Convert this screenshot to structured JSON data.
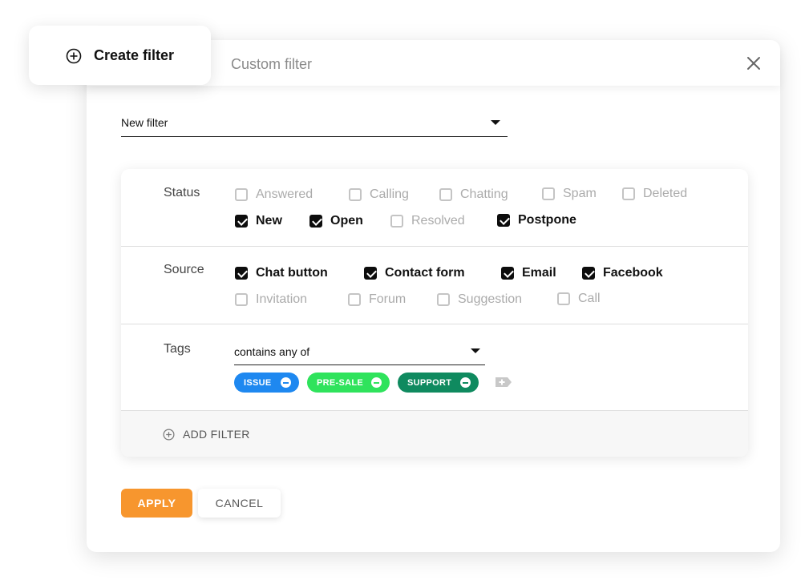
{
  "create_tab": {
    "label": "Create filter",
    "icon": "plus-circle-icon"
  },
  "modal": {
    "title": "Custom filter",
    "close_icon": "close-icon"
  },
  "filter_select": {
    "value": "New filter"
  },
  "sections": {
    "status": {
      "label": "Status",
      "options": [
        {
          "label": "Answered",
          "checked": false
        },
        {
          "label": "Calling",
          "checked": false
        },
        {
          "label": "Chatting",
          "checked": false
        },
        {
          "label": "Spam",
          "checked": false
        },
        {
          "label": "Deleted",
          "checked": false
        },
        {
          "label": "New",
          "checked": true
        },
        {
          "label": "Open",
          "checked": true
        },
        {
          "label": "Resolved",
          "checked": false
        },
        {
          "label": "Postpone",
          "checked": true
        }
      ]
    },
    "source": {
      "label": "Source",
      "options": [
        {
          "label": "Chat button",
          "checked": true
        },
        {
          "label": "Contact form",
          "checked": true
        },
        {
          "label": "Email",
          "checked": true
        },
        {
          "label": "Facebook",
          "checked": true
        },
        {
          "label": "Invitation",
          "checked": false
        },
        {
          "label": "Forum",
          "checked": false
        },
        {
          "label": "Suggestion",
          "checked": false
        },
        {
          "label": "Call",
          "checked": false
        }
      ]
    },
    "tags": {
      "label": "Tags",
      "condition": "contains any of",
      "items": [
        {
          "label": "ISSUE",
          "color": "#1e88f0"
        },
        {
          "label": "PRE-SALE",
          "color": "#2fe35c"
        },
        {
          "label": "SUPPORT",
          "color": "#0f8a5f"
        }
      ],
      "add_icon": "tag-add-icon"
    }
  },
  "add_filter": {
    "label": "ADD FILTER",
    "icon": "plus-circle-icon"
  },
  "buttons": {
    "apply": "APPLY",
    "cancel": "CANCEL"
  },
  "colors": {
    "accent": "#f7962e",
    "checked": "#0d0d0d",
    "unchecked_text": "#ababab"
  }
}
